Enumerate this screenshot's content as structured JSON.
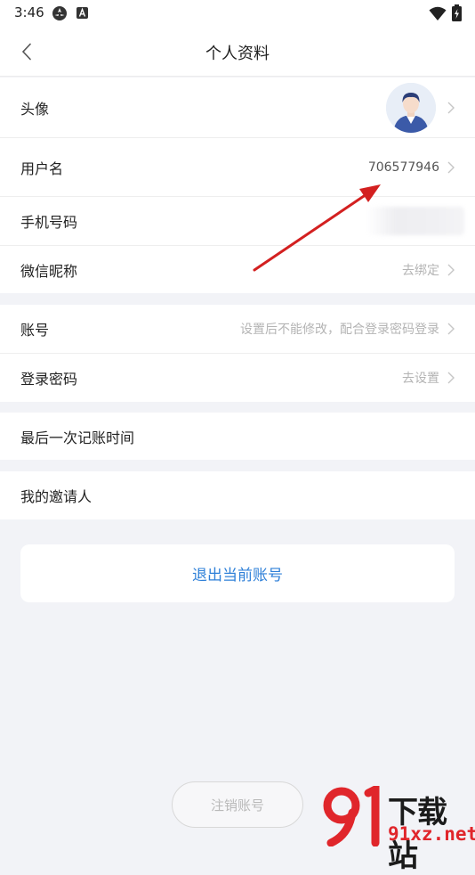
{
  "status_bar": {
    "time": "3:46",
    "icons": [
      "app-notification-icon",
      "a-notification-icon",
      "wifi-icon",
      "battery-charging-icon"
    ]
  },
  "nav": {
    "title": "个人资料",
    "back_icon": "chevron-left-icon"
  },
  "profile": {
    "avatar": {
      "label": "头像"
    },
    "username": {
      "label": "用户名",
      "value": "706577946"
    },
    "phone": {
      "label": "手机号码"
    },
    "wechat": {
      "label": "微信昵称",
      "value": "去绑定"
    }
  },
  "account": {
    "account": {
      "label": "账号",
      "value": "设置后不能修改，配合登录密码登录"
    },
    "password": {
      "label": "登录密码",
      "value": "去设置"
    }
  },
  "last_record": {
    "label": "最后一次记账时间"
  },
  "inviter": {
    "label": "我的邀请人"
  },
  "logout": {
    "label": "退出当前账号"
  },
  "cancel_account": {
    "label": "注销账号"
  },
  "watermark": {
    "top": "下载站",
    "bottom": "91xz.net"
  },
  "colors": {
    "accent": "#2f80d8",
    "background": "#f2f3f7",
    "annotation_arrow": "#d32020",
    "hint_text": "#b4b4b4"
  }
}
